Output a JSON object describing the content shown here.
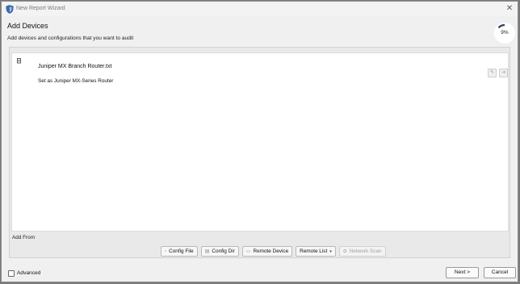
{
  "window": {
    "title": "New Report Wizard",
    "close_glyph": "✕",
    "icon": "shield-app-icon"
  },
  "page": {
    "title": "Add Devices",
    "subtitle": "Add devices and configurations that you want to audit"
  },
  "progress": {
    "label": "9%",
    "value": 0.09,
    "arc_color": "#3a4a6b"
  },
  "devices": [
    {
      "name": "Juniper MX Branch Router.txt",
      "type": "Set as Juniper MX-Series Router",
      "icon": "device-file-icon"
    }
  ],
  "add_from": {
    "label": "Add From",
    "buttons": {
      "config_file": "Config File",
      "config_dir": "Config Dir",
      "remote_device": "Remote Device",
      "remote_list": "Remote List",
      "remote_list_caret": "▾",
      "network_scan": "Network Scan"
    }
  },
  "footer": {
    "advanced_label": "Advanced",
    "advanced_checked": false,
    "next_label": "Next >",
    "cancel_label": "Cancel"
  }
}
